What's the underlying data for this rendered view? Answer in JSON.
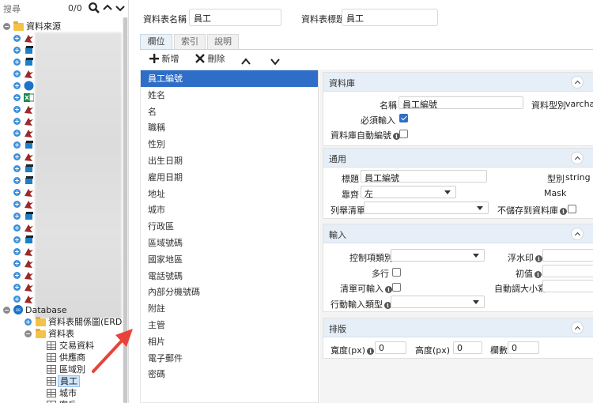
{
  "search": {
    "placeholder": "搜尋",
    "count": "0/0"
  },
  "tree": {
    "root_label": "資料來源",
    "database_label": "Database",
    "erd_label": "資料表關係圖(ERD)",
    "tables_label": "資料表",
    "tables": [
      "交易資料",
      "供應商",
      "區域別",
      "員工",
      "城市",
      "客戶"
    ],
    "selected_table": "員工"
  },
  "header": {
    "table_name_label": "資料表名稱",
    "table_name_value": "員工",
    "table_title_label": "資料表標題",
    "table_title_value": "員工"
  },
  "tabs": [
    "欄位",
    "索引",
    "說明"
  ],
  "toolbar": {
    "add": "新增",
    "delete": "刪除"
  },
  "fields": [
    "員工編號",
    "姓名",
    "名",
    "職稱",
    "性別",
    "出生日期",
    "雇用日期",
    "地址",
    "城市",
    "行政區",
    "區域號碼",
    "國家地區",
    "電話號碼",
    "內部分機號碼",
    "附註",
    "主管",
    "相片",
    "電子郵件",
    "密碼"
  ],
  "selected_field": "員工編號",
  "sections": {
    "database": {
      "title": "資料庫",
      "name_label": "名稱",
      "name_value": "員工編號",
      "type_label": "資料型別",
      "type_value": "varcha",
      "required_label": "必須輸入",
      "required": true,
      "autonum_label": "資料庫自動編號",
      "autonum": false
    },
    "general": {
      "title": "通用",
      "caption_label": "標題",
      "caption_value": "員工編號",
      "type_label": "型別",
      "type_value": "string",
      "align_label": "靠齊",
      "align_value": "左",
      "mask_label": "Mask",
      "list_label": "列舉清單",
      "list_value": "",
      "nostore_label": "不儲存到資料庫",
      "nostore": false
    },
    "input": {
      "title": "輸入",
      "control_label": "控制項類別",
      "watermark_label": "浮水印",
      "multiline_label": "多行",
      "multiline": false,
      "initial_label": "初值",
      "clear_label": "清單可輸入",
      "clear": false,
      "autosize_label": "自動調大小寫",
      "mobile_label": "行動輸入類型"
    },
    "layout": {
      "title": "排版",
      "width_label": "寬度(px)",
      "width_value": "0",
      "height_label": "高度(px)",
      "height_value": "0",
      "cols_label": "欄數",
      "cols_value": "0"
    }
  },
  "colors": {
    "accent": "#2e6ec9",
    "section_header": "#e6eef7",
    "arrow": "#e8433a"
  }
}
